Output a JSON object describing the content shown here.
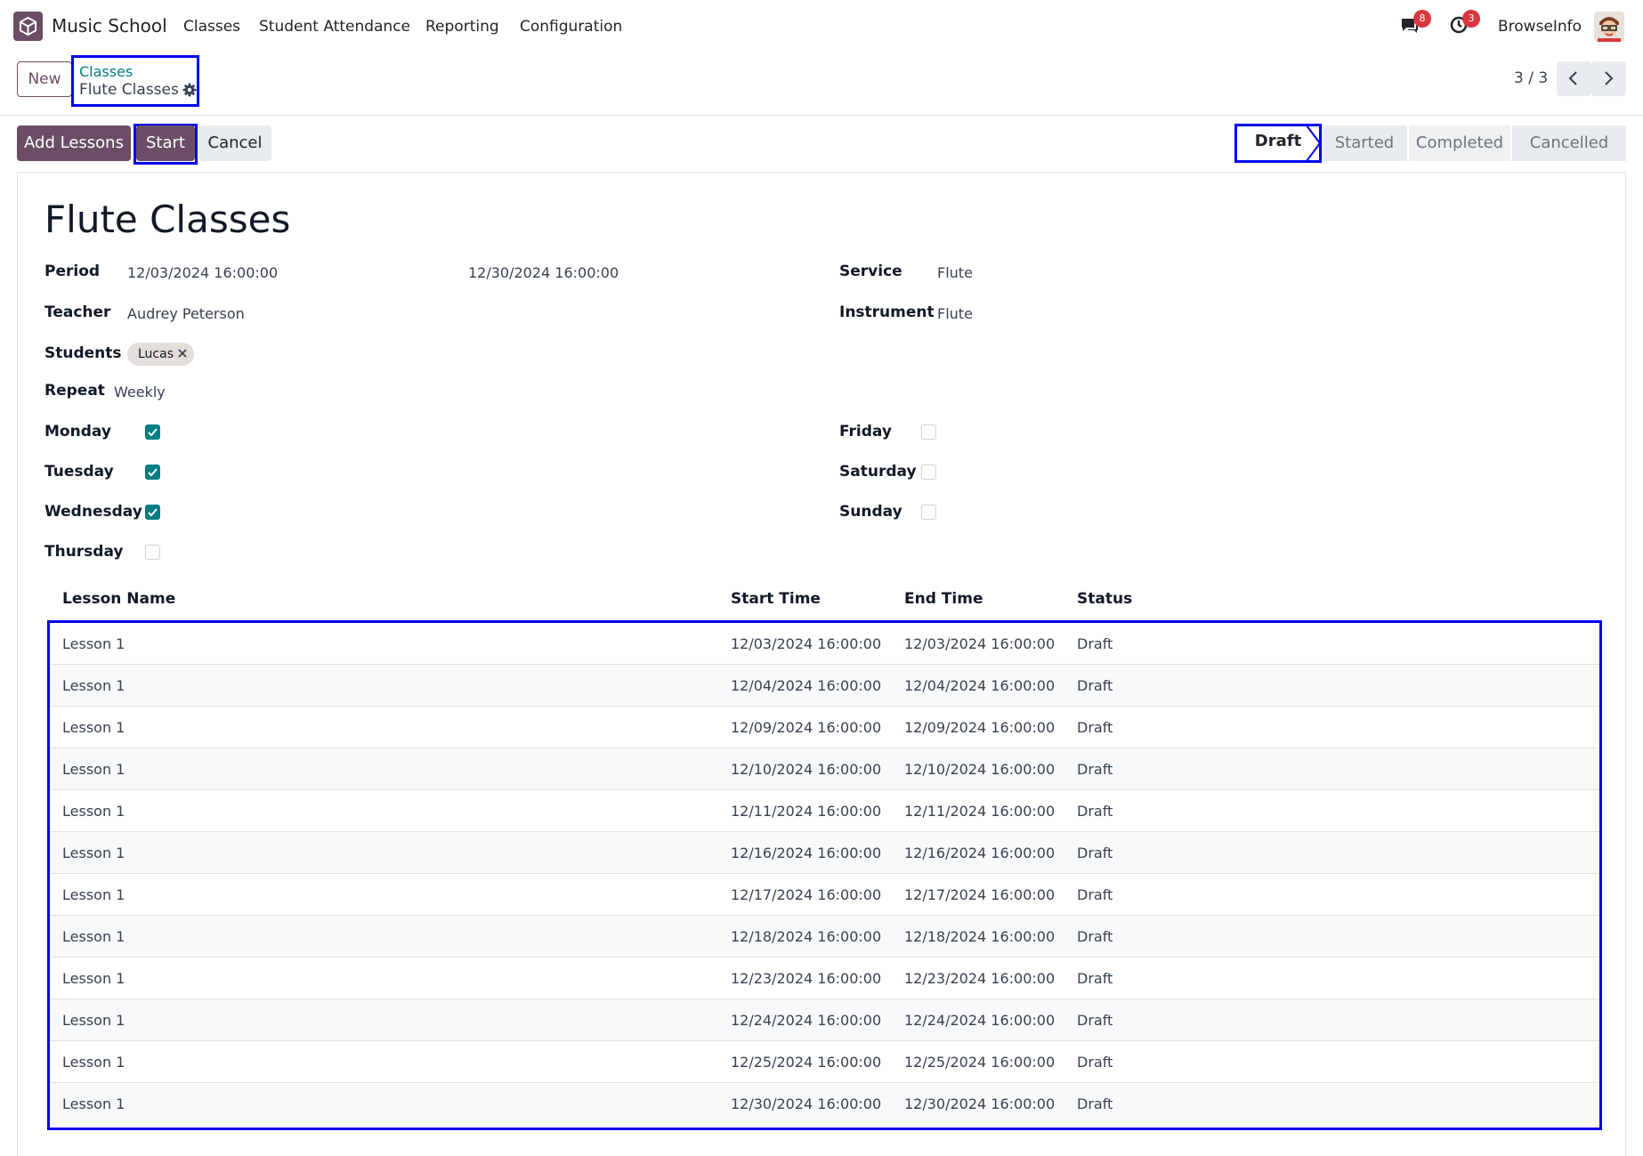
{
  "navbar": {
    "app_name": "Music School",
    "menu": [
      "Classes",
      "Student Attendance",
      "Reporting",
      "Configuration"
    ],
    "messages_count": "8",
    "activities_count": "3",
    "company": "BrowseInfo"
  },
  "control_panel": {
    "new_label": "New",
    "breadcrumb_parent": "Classes",
    "breadcrumb_current": "Flute Classes",
    "pager": "3 / 3"
  },
  "actions": {
    "add_lessons": "Add Lessons",
    "start": "Start",
    "cancel": "Cancel"
  },
  "stages": {
    "items": [
      "Draft",
      "Started",
      "Completed",
      "Cancelled"
    ],
    "current": "Draft"
  },
  "form": {
    "title": "Flute Classes",
    "period_label": "Period",
    "period_start": "12/03/2024 16:00:00",
    "period_end": "12/30/2024 16:00:00",
    "service_label": "Service",
    "service_value": "Flute",
    "teacher_label": "Teacher",
    "teacher_value": "Audrey Peterson",
    "instrument_label": "Instrument",
    "instrument_value": "Flute",
    "students_label": "Students",
    "students": [
      "Lucas"
    ],
    "repeat_label": "Repeat",
    "repeat_value": "Weekly",
    "days": [
      {
        "label": "Monday",
        "checked": true
      },
      {
        "label": "Tuesday",
        "checked": true
      },
      {
        "label": "Wednesday",
        "checked": true
      },
      {
        "label": "Thursday",
        "checked": false
      },
      {
        "label": "Friday",
        "checked": false
      },
      {
        "label": "Saturday",
        "checked": false
      },
      {
        "label": "Sunday",
        "checked": false
      }
    ]
  },
  "lessons": {
    "headers": [
      "Lesson Name",
      "Start Time",
      "End Time",
      "Status"
    ],
    "rows": [
      [
        "Lesson 1",
        "12/03/2024 16:00:00",
        "12/03/2024 16:00:00",
        "Draft"
      ],
      [
        "Lesson 1",
        "12/04/2024 16:00:00",
        "12/04/2024 16:00:00",
        "Draft"
      ],
      [
        "Lesson 1",
        "12/09/2024 16:00:00",
        "12/09/2024 16:00:00",
        "Draft"
      ],
      [
        "Lesson 1",
        "12/10/2024 16:00:00",
        "12/10/2024 16:00:00",
        "Draft"
      ],
      [
        "Lesson 1",
        "12/11/2024 16:00:00",
        "12/11/2024 16:00:00",
        "Draft"
      ],
      [
        "Lesson 1",
        "12/16/2024 16:00:00",
        "12/16/2024 16:00:00",
        "Draft"
      ],
      [
        "Lesson 1",
        "12/17/2024 16:00:00",
        "12/17/2024 16:00:00",
        "Draft"
      ],
      [
        "Lesson 1",
        "12/18/2024 16:00:00",
        "12/18/2024 16:00:00",
        "Draft"
      ],
      [
        "Lesson 1",
        "12/23/2024 16:00:00",
        "12/23/2024 16:00:00",
        "Draft"
      ],
      [
        "Lesson 1",
        "12/24/2024 16:00:00",
        "12/24/2024 16:00:00",
        "Draft"
      ],
      [
        "Lesson 1",
        "12/25/2024 16:00:00",
        "12/25/2024 16:00:00",
        "Draft"
      ],
      [
        "Lesson 1",
        "12/30/2024 16:00:00",
        "12/30/2024 16:00:00",
        "Draft"
      ]
    ]
  },
  "colors": {
    "brand": "#6b4d66",
    "accent": "#017e84",
    "badge": "#d9363e",
    "highlight_frame": "#0000ee"
  },
  "icons": [
    "app-logo-icon",
    "messages-icon",
    "activities-icon",
    "gear-icon",
    "chevron-left-icon",
    "chevron-right-icon",
    "remove-tag-icon",
    "check-icon"
  ]
}
